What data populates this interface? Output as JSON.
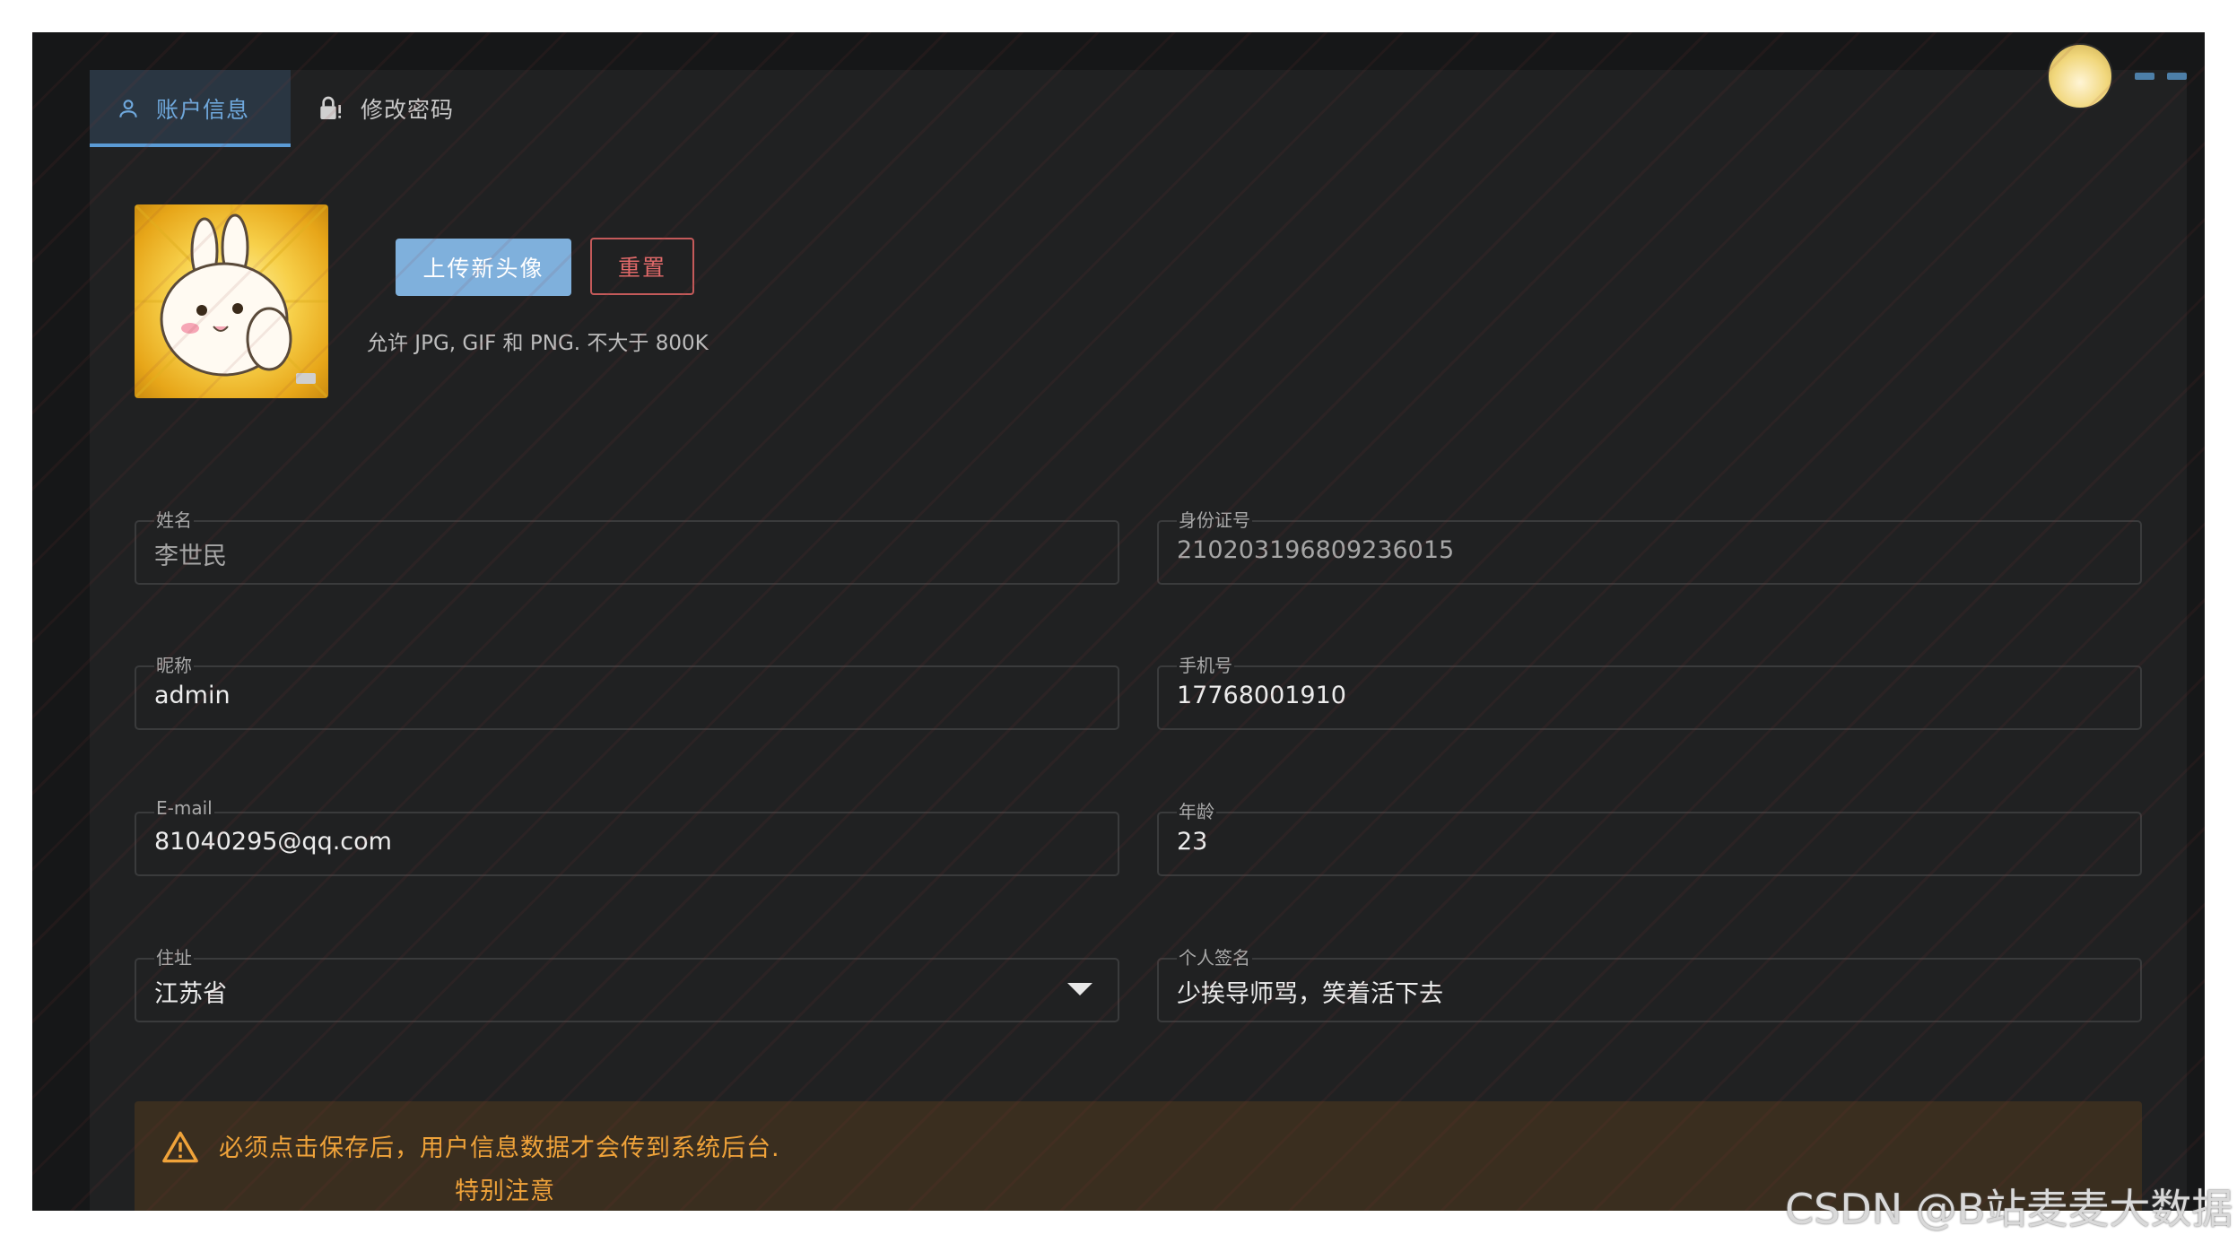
{
  "tabs": [
    {
      "label": "账户信息",
      "icon": "user-icon",
      "active": true
    },
    {
      "label": "修改密码",
      "icon": "lock-icon",
      "active": false
    }
  ],
  "avatar_section": {
    "upload_label": "上传新头像",
    "reset_label": "重置",
    "hint": "允许 JPG, GIF 和 PNG. 不大于 800K"
  },
  "form": {
    "name": {
      "label": "姓名",
      "value": "李世民"
    },
    "id_number": {
      "label": "身份证号",
      "value": "210203196809236015"
    },
    "nickname": {
      "label": "昵称",
      "value": "admin"
    },
    "phone": {
      "label": "手机号",
      "value": "17768001910"
    },
    "email": {
      "label": "E-mail",
      "value": "81040295@qq.com"
    },
    "age": {
      "label": "年龄",
      "value": "23"
    },
    "address": {
      "label": "住址",
      "value": "江苏省"
    },
    "signature": {
      "label": "个人签名",
      "value": "少挨导师骂，笑着活下去"
    }
  },
  "alert": {
    "message": "必须点击保存后，用户信息数据才会传到系统后台.",
    "submessage": "特别注意",
    "color": "#f0a33a"
  },
  "watermark": {
    "csdn": "CSDN @B站麦麦大数据"
  },
  "colors": {
    "accent": "#5b9bd5",
    "background": "#202122",
    "danger": "#e26a6a"
  }
}
